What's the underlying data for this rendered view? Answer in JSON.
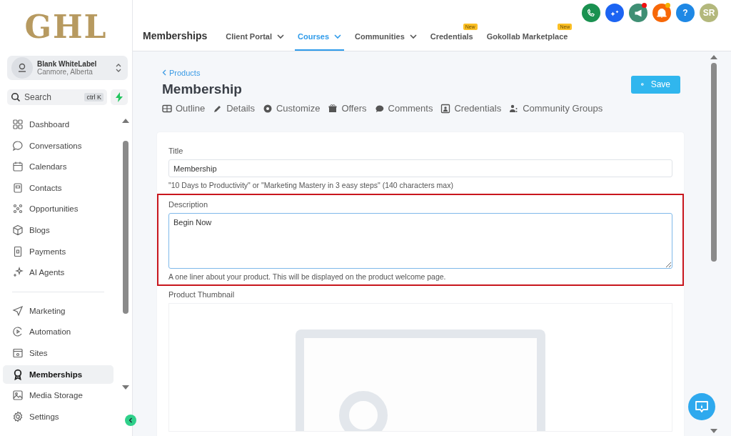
{
  "sidebar": {
    "logo": "GHL",
    "account": {
      "name": "Blank WhiteLabel",
      "location": "Canmore, Alberta"
    },
    "search": {
      "placeholder": "Search",
      "shortcut": "ctrl K"
    },
    "nav_groups": [
      [
        {
          "label": "Dashboard",
          "selected": false
        },
        {
          "label": "Conversations",
          "selected": false
        },
        {
          "label": "Calendars",
          "selected": false
        },
        {
          "label": "Contacts",
          "selected": false
        },
        {
          "label": "Opportunities",
          "selected": false
        },
        {
          "label": "Blogs",
          "selected": false
        },
        {
          "label": "Payments",
          "selected": false
        },
        {
          "label": "AI Agents",
          "selected": false
        }
      ],
      [
        {
          "label": "Marketing",
          "selected": false
        },
        {
          "label": "Automation",
          "selected": false
        },
        {
          "label": "Sites",
          "selected": false
        },
        {
          "label": "Memberships",
          "selected": true
        },
        {
          "label": "Media Storage",
          "selected": false
        },
        {
          "label": "Settings",
          "selected": false
        }
      ]
    ]
  },
  "header": {
    "title": "Memberships",
    "tabs": [
      {
        "label": "Client Portal",
        "selected": false,
        "dropdown": true
      },
      {
        "label": "Courses",
        "selected": true,
        "dropdown": true
      },
      {
        "label": "Communities",
        "selected": false,
        "dropdown": true
      },
      {
        "label": "Credentials",
        "selected": false,
        "dropdown": false,
        "badge": "New"
      },
      {
        "label": "Gokollab Marketplace",
        "selected": false,
        "dropdown": false,
        "badge": "New"
      }
    ],
    "actions": [
      {
        "color": "#1a9150",
        "notification": false
      },
      {
        "color": "#1c64f2",
        "notification": false
      },
      {
        "color": "#3f8f74",
        "notification": true
      },
      {
        "color": "#f76707",
        "notification": true
      },
      {
        "color": "#1e88e5",
        "notification": false,
        "text": "?"
      },
      {
        "color": "#b3b87c",
        "notification": false,
        "text": "SR"
      }
    ]
  },
  "page": {
    "breadcrumb": "Products",
    "title": "Membership",
    "save_button": "Save",
    "tabs": [
      {
        "label": "Outline",
        "selected": false
      },
      {
        "label": "Details",
        "selected": false
      },
      {
        "label": "Customize",
        "selected": false
      },
      {
        "label": "Offers",
        "selected": false
      },
      {
        "label": "Comments",
        "selected": false
      },
      {
        "label": "Credentials",
        "selected": false
      },
      {
        "label": "Community Groups",
        "selected": false
      }
    ],
    "form": {
      "title": {
        "label": "Title",
        "value": "Membership",
        "hint": "\"10 Days to Productivity\" or \"Marketing Mastery in 3 easy steps\" (140 characters max)"
      },
      "description": {
        "label": "Description",
        "value": "Begin Now",
        "hint": "A one liner about your product. This will be displayed on the product welcome page.",
        "highlighted": true
      },
      "thumbnail": {
        "label": "Product Thumbnail"
      }
    }
  }
}
